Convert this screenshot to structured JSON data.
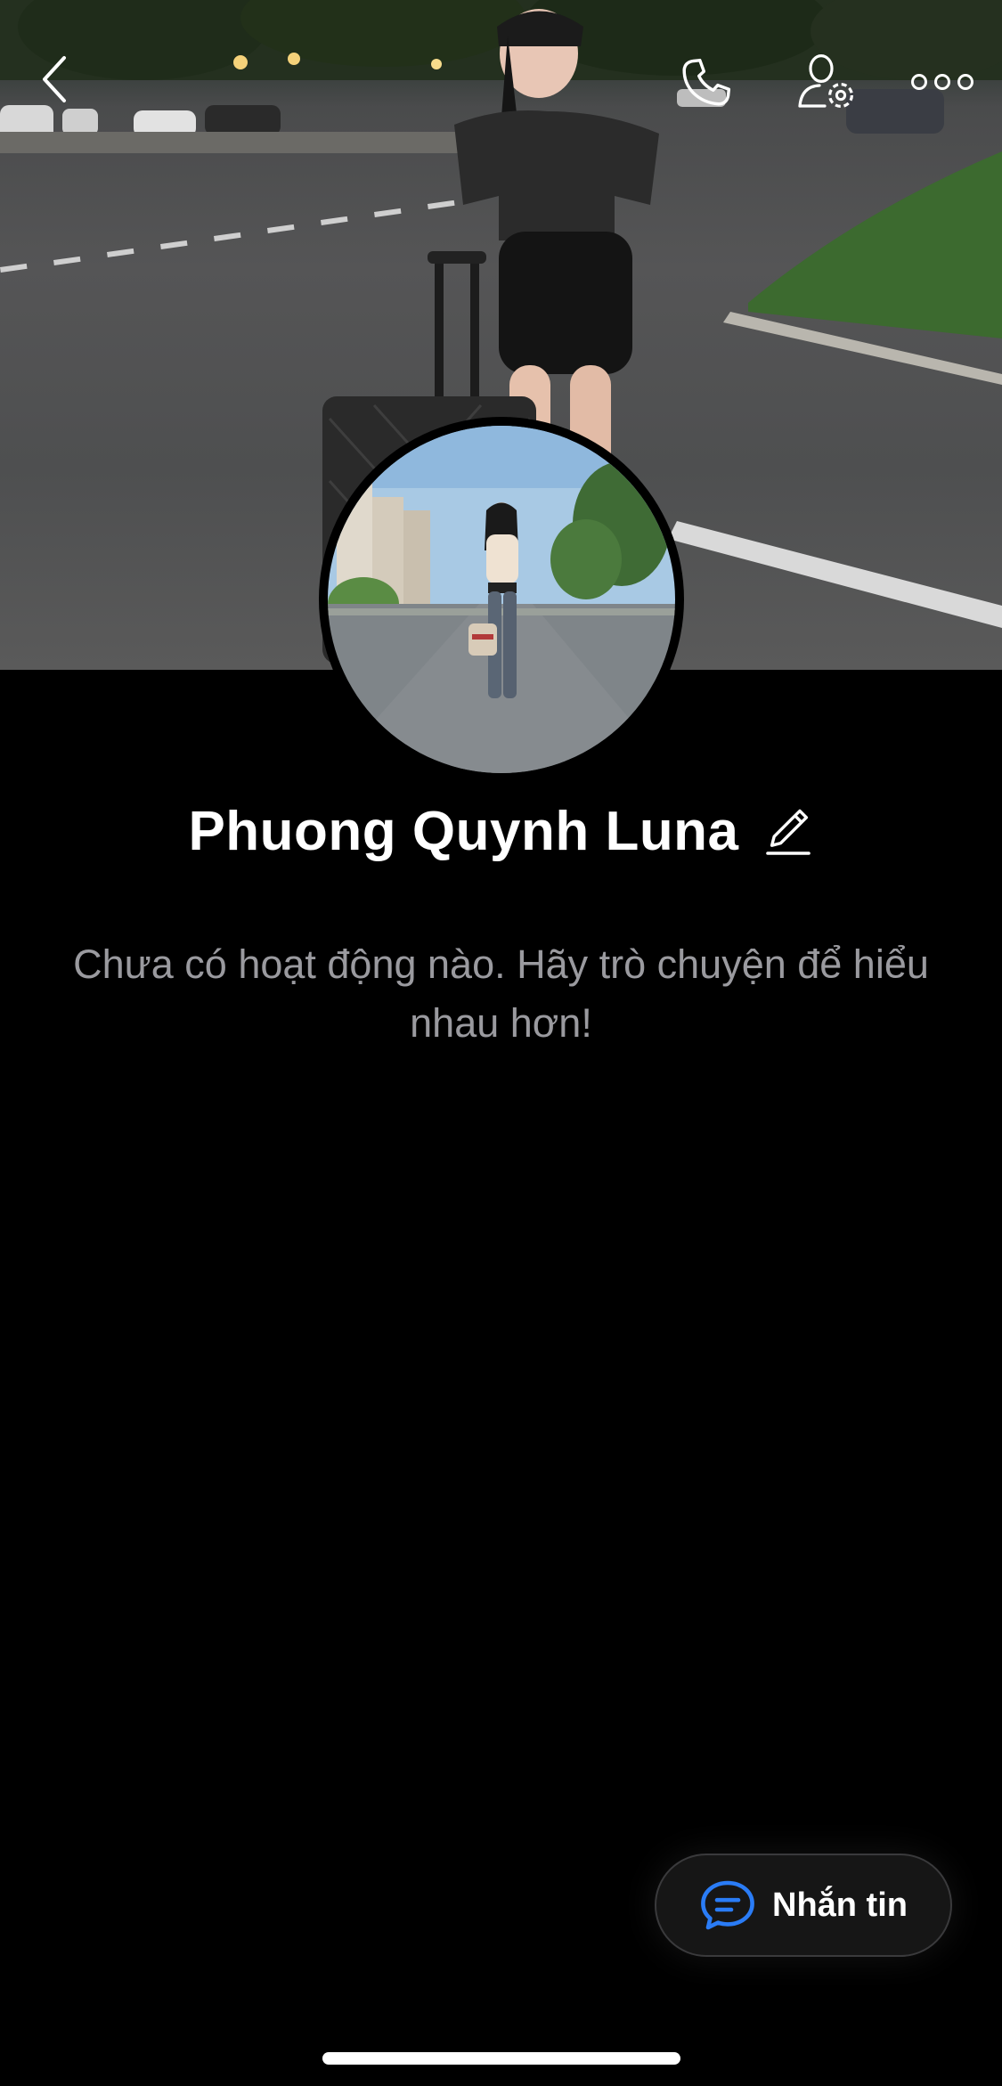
{
  "header": {
    "back_icon": "chevron-left-icon",
    "call_icon": "phone-icon",
    "settings_icon": "user-settings-icon",
    "more_icon": "more-horizontal-icon"
  },
  "profile": {
    "name": "Phuong Quynh Luna",
    "edit_icon": "pencil-icon"
  },
  "feed": {
    "empty_message": "Chưa có hoạt động nào. Hãy trò chuyện để hiểu nhau hơn!"
  },
  "message_button": {
    "label": "Nhắn tin",
    "icon": "chat-bubble-icon",
    "icon_color": "#2a7cf6"
  }
}
